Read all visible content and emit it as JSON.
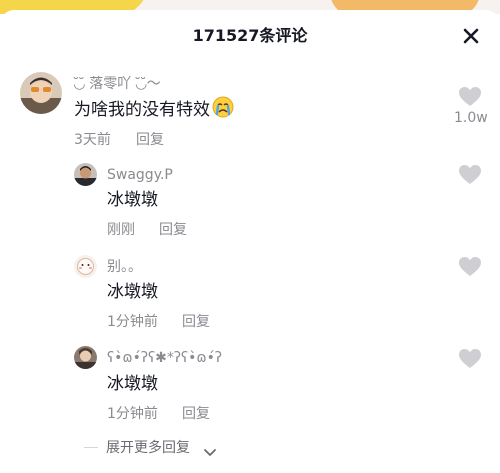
{
  "header": {
    "title": "171527条评论"
  },
  "main_comment": {
    "username": "◟̆◞̆ 落零吖 ◟̆◞̆～",
    "text": "为啥我的没有特效",
    "emoji": "crying-face-emoji",
    "time": "3天前",
    "reply_label": "回复",
    "likes": "1.0w"
  },
  "replies": [
    {
      "username": "Swaggy.P",
      "text": "冰墩墩",
      "time": "刚刚",
      "reply_label": "回复"
    },
    {
      "username": "别。。",
      "text": "冰墩墩",
      "time": "1分钟前",
      "reply_label": "回复"
    },
    {
      "username": "ʕ•̀ɷ•́ʔʕ✱*ʔʕ•̀ɷ•́ʔ",
      "text": "冰墩墩",
      "time": "1分钟前",
      "reply_label": "回复"
    }
  ],
  "expand": {
    "label": "展开更多回复"
  },
  "icons": {
    "close": "close-icon",
    "like": "heart-icon",
    "expand": "chevron-down-icon"
  },
  "colors": {
    "text": "#161823",
    "secondary": "#8a8b91",
    "heart": "#cfcfd3"
  }
}
